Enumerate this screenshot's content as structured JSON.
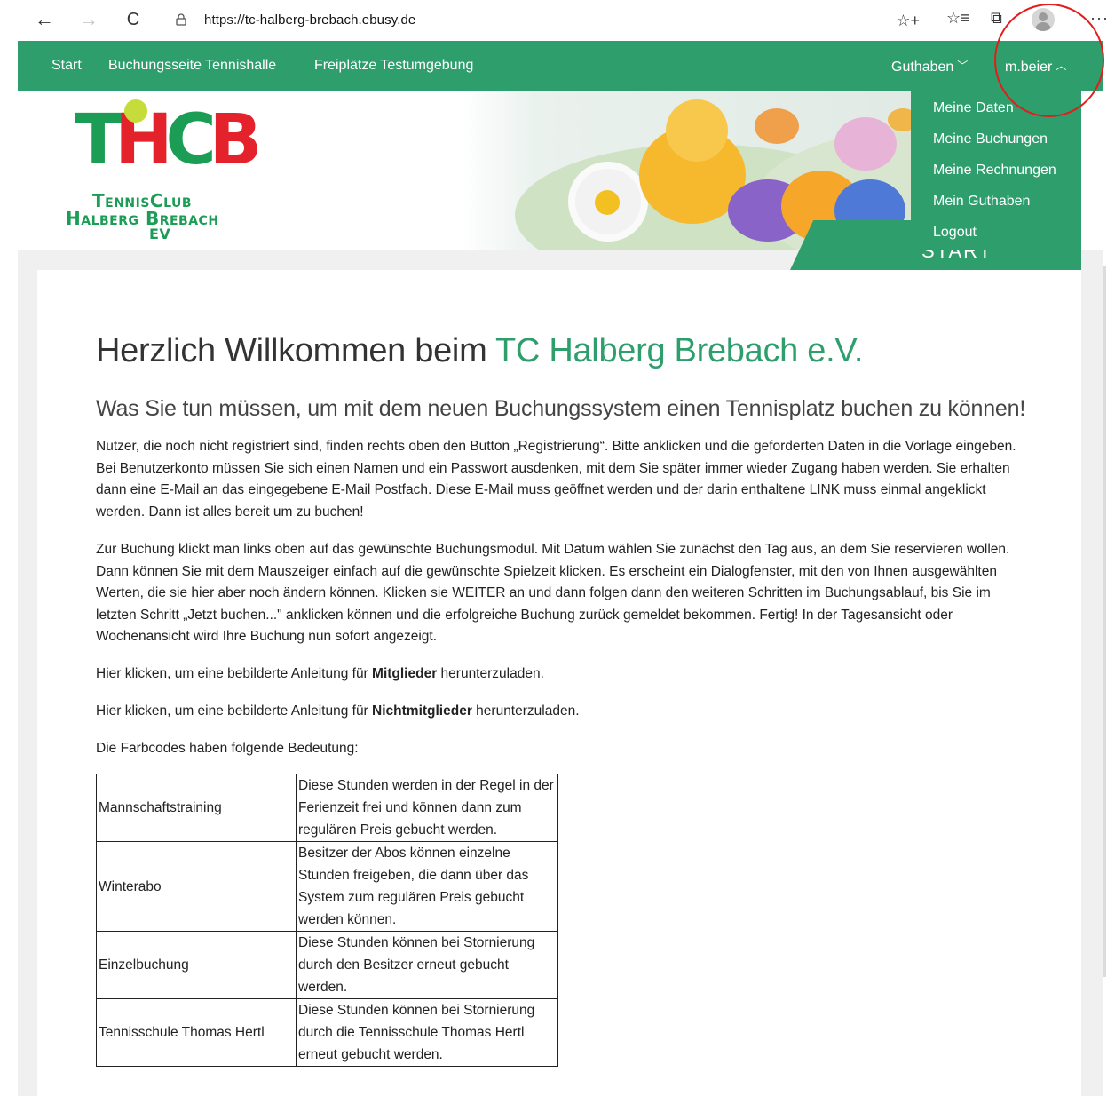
{
  "browser": {
    "back_icon": "←",
    "forward_icon": "→",
    "reload_icon": "C",
    "url_scheme": "https://",
    "url_host": "tc-halberg-brebach.ebusy.de",
    "add_favorite_icon": "☆+",
    "favorites_icon": "☆≡",
    "collections_icon": "⧉",
    "more_icon": "···"
  },
  "nav": {
    "start": "Start",
    "buchungsseite": "Buchungsseite Tennishalle",
    "freiplaetze": "Freiplätze Testumgebung",
    "guthaben": "Guthaben",
    "user": "m.beier",
    "chevron_down": "﹀",
    "chevron_up": "︿"
  },
  "dropdown": {
    "items": [
      "Meine Daten",
      "Meine Buchungen",
      "Meine Rechnungen",
      "Mein Guthaben",
      "Logout"
    ]
  },
  "logo": {
    "letters_t": "T",
    "letters_h": "H",
    "letters_c": "C",
    "letters_b": "B",
    "line1": "TennisClub",
    "line2": "Halberg Brebach",
    "line3": "eV"
  },
  "header": {
    "start_tab": "START"
  },
  "main": {
    "title_prefix": "Herzlich Willkommen beim ",
    "title_accent": "TC Halberg Brebach e.V.",
    "subtitle": "Was Sie tun müssen, um mit dem neuen Buchungssystem einen Tennisplatz buchen zu können!",
    "p1": "Nutzer, die noch nicht registriert sind, finden rechts oben den Button „Registrierung“. Bitte anklicken und die geforderten Daten in die Vorlage eingeben. Bei Benutzerkonto müssen Sie sich einen Namen und ein Passwort ausdenken, mit dem Sie später immer wieder Zugang haben werden. Sie erhalten dann eine E-Mail an das eingegebene E-Mail Postfach. Diese E-Mail muss geöffnet werden und der darin enthaltene LINK muss einmal angeklickt werden. Dann ist alles bereit um zu buchen!",
    "p2": "Zur Buchung klickt man links oben auf das gewünschte Buchungsmodul. Mit Datum wählen Sie zunächst den Tag aus, an dem Sie reservieren wollen. Dann können Sie mit dem Mauszeiger einfach auf die gewünschte Spielzeit klicken. Es erscheint ein Dialogfenster, mit den von Ihnen ausgewählten Werten, die sie hier aber noch ändern können. Klicken sie WEITER an und dann folgen dann den weiteren  Schritten im Buchungsablauf, bis Sie im letzten Schritt „Jetzt buchen...\" anklicken können und die erfolgreiche Buchung zurück gemeldet bekommen. Fertig! In der Tagesansicht oder Wochenansicht wird Ihre Buchung nun sofort angezeigt.",
    "p3_prefix": "Hier klicken, um eine bebilderte Anleitung für ",
    "p3_bold": "Mitglieder",
    "p3_suffix": " herunterzuladen.",
    "p4_prefix": "Hier klicken, um eine bebilderte Anleitung für ",
    "p4_bold": "Nichtmitglieder",
    "p4_suffix": " herunterzuladen.",
    "p5": "Die Farbcodes haben folgende Bedeutung:"
  },
  "legend": {
    "rows": [
      {
        "name": "Mannschaftstraining",
        "desc": "Diese Stunden werden in der Regel in der Ferienzeit frei und können dann zum regulären Preis gebucht werden."
      },
      {
        "name": "Winterabo",
        "desc": "Besitzer der Abos können einzelne Stunden freigeben, die dann über das System zum regulären Preis gebucht werden können."
      },
      {
        "name": "Einzelbuchung",
        "desc": "Diese Stunden können bei Stornierung durch den Besitzer erneut gebucht werden."
      },
      {
        "name": "Tennisschule Thomas Hertl",
        "desc": "Diese Stunden können bei Stornierung durch die Tennisschule Thomas Hertl erneut gebucht werden."
      }
    ]
  },
  "colors": {
    "brand_green": "#2e9e6d",
    "logo_green": "#1b9d55",
    "logo_red": "#e4222b",
    "highlight_red": "#e31c1c"
  }
}
